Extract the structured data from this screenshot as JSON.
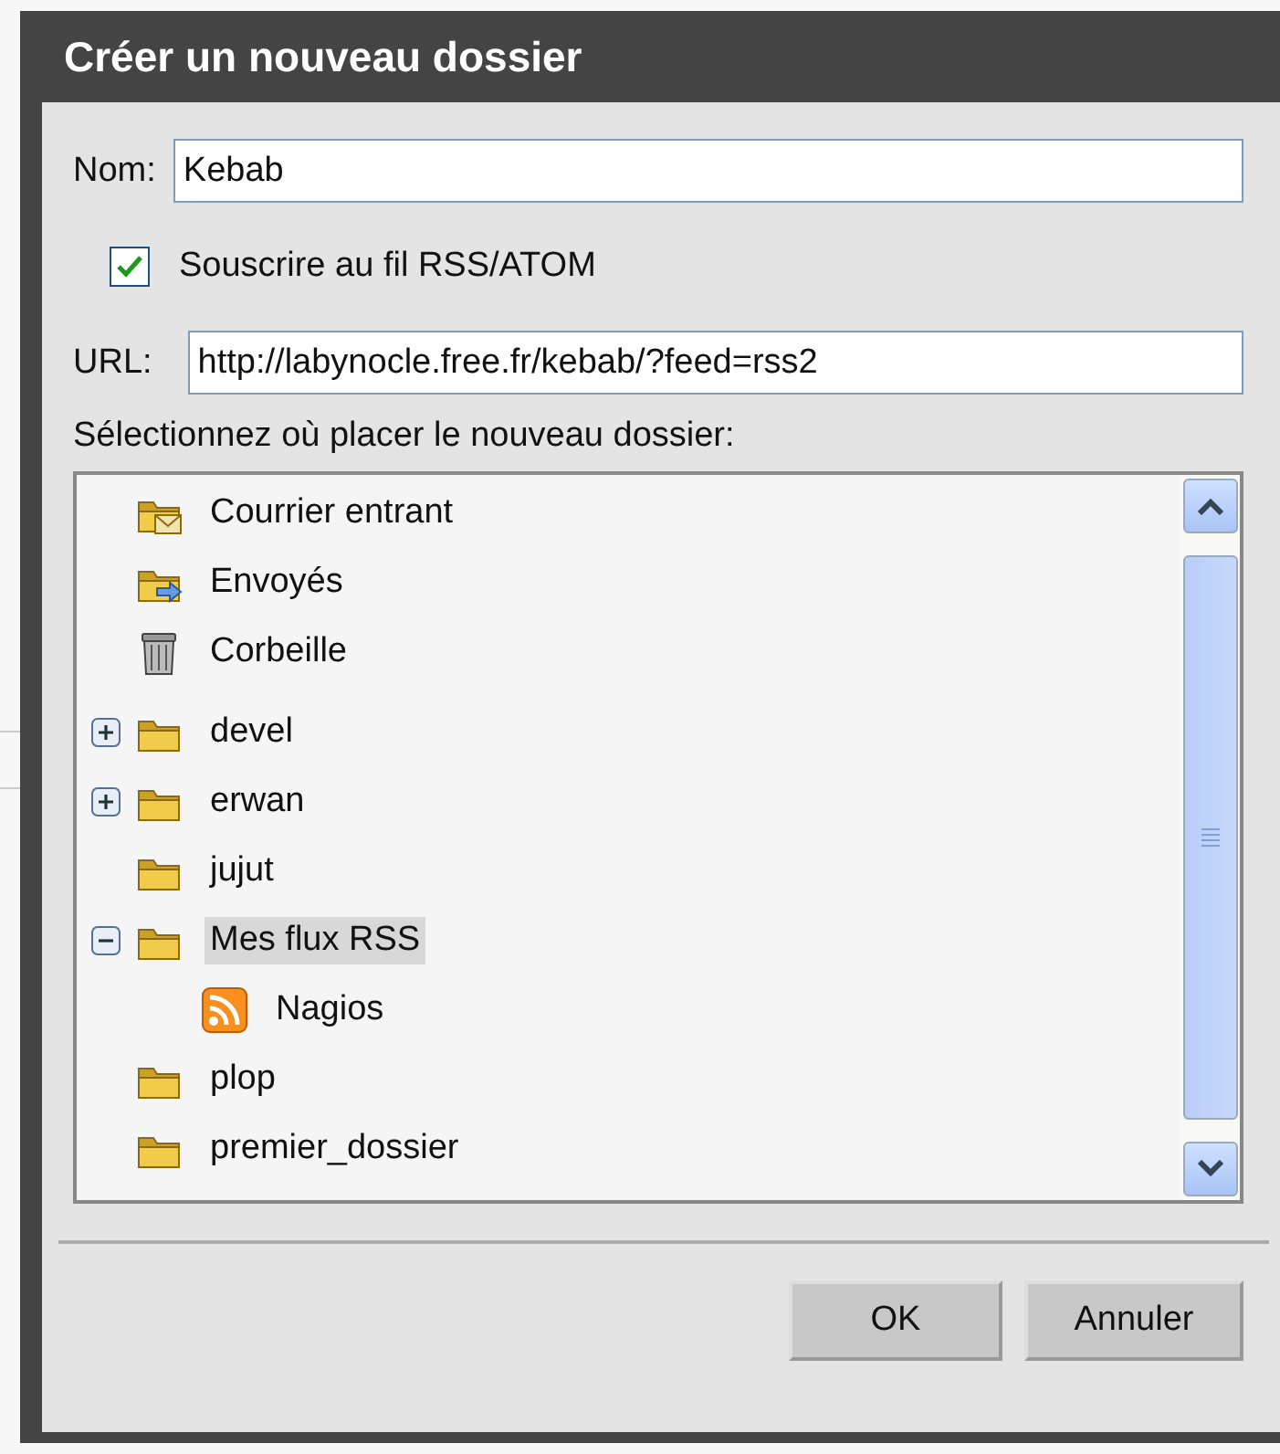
{
  "dialog": {
    "title": "Créer un nouveau dossier",
    "name_field": {
      "label": "Nom:",
      "value": "Kebab"
    },
    "subscribe": {
      "label": "Souscrire au fil RSS/ATOM",
      "checked": true
    },
    "url_field": {
      "label": "URL:",
      "value": "http://labynocle.free.fr/kebab/?feed=rss2"
    },
    "tree_label": "Sélectionnez où placer le nouveau dossier:",
    "tree": [
      {
        "label": "Courrier entrant",
        "kind": "inbox",
        "selected": false
      },
      {
        "label": "Envoyés",
        "kind": "sent",
        "selected": false
      },
      {
        "label": "Corbeille",
        "kind": "trash",
        "selected": false
      },
      {
        "label": "devel",
        "kind": "folder",
        "expanded": false,
        "selected": false
      },
      {
        "label": "erwan",
        "kind": "folder",
        "expanded": false,
        "selected": false
      },
      {
        "label": "jujut",
        "kind": "folder",
        "selected": false
      },
      {
        "label": "Mes flux RSS",
        "kind": "folder",
        "expanded": true,
        "selected": true,
        "children": [
          {
            "label": "Nagios",
            "kind": "rss",
            "selected": false
          }
        ]
      },
      {
        "label": "plop",
        "kind": "folder",
        "selected": false
      },
      {
        "label": "premier_dossier",
        "kind": "folder",
        "selected": false
      }
    ],
    "buttons": [
      "OK",
      "Annuler"
    ]
  }
}
